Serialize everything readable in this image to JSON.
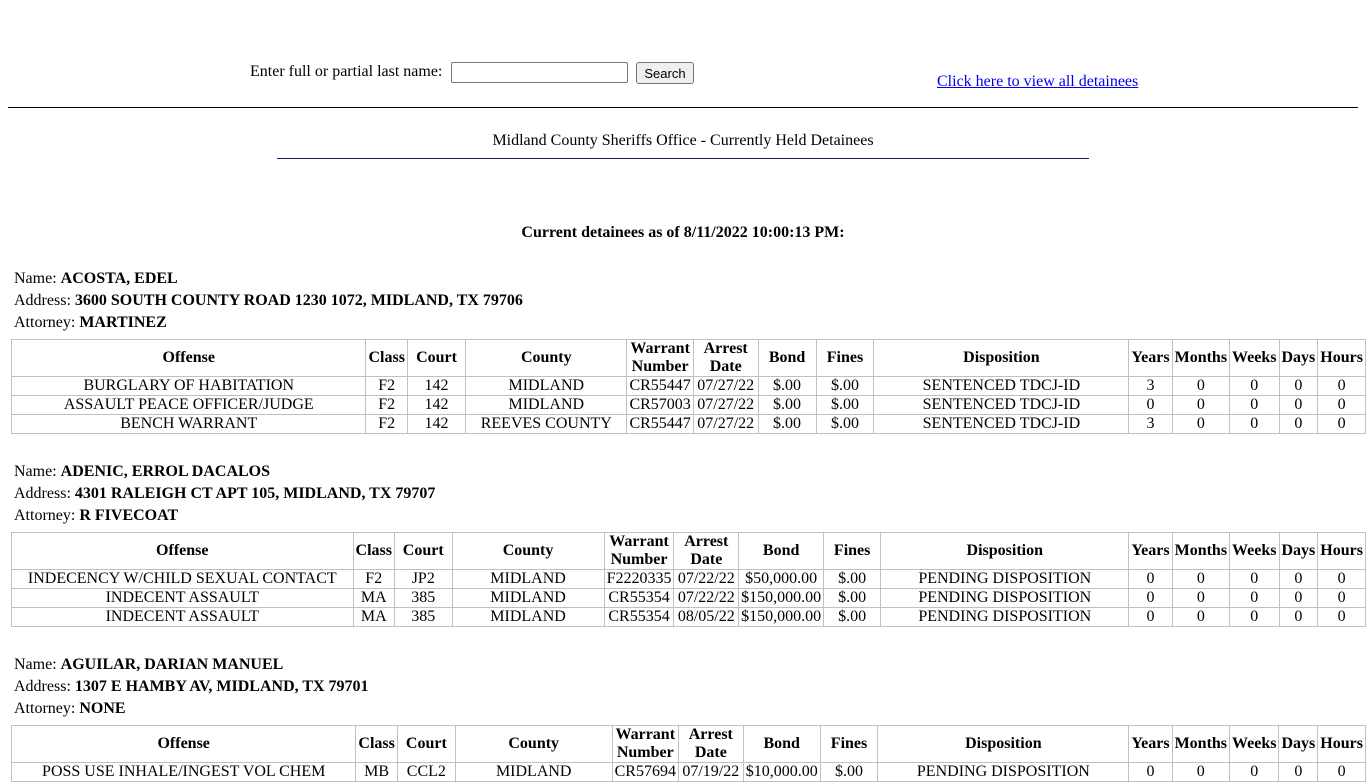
{
  "search": {
    "label": "Enter full or partial last name:",
    "input_value": "",
    "button_label": "Search"
  },
  "view_all_link": "Click here to view all detainees",
  "office_title": "Midland County Sheriffs Office - Currently Held Detainees",
  "as_of": "Current detainees as of 8/11/2022 10:00:13 PM:",
  "labels": {
    "name": "Name:",
    "address": "Address:",
    "attorney": "Attorney:"
  },
  "columns": [
    "Offense",
    "Class",
    "Court",
    "County",
    "Warrant Number",
    "Arrest Date",
    "Bond",
    "Fines",
    "Disposition",
    "Years",
    "Months",
    "Weeks",
    "Days",
    "Hours"
  ],
  "detainees": [
    {
      "name": "ACOSTA, EDEL",
      "address": "3600 SOUTH COUNTY ROAD 1230 1072, MIDLAND, TX 79706",
      "attorney": "MARTINEZ",
      "offenses": [
        [
          "BURGLARY OF HABITATION",
          "F2",
          "142",
          "MIDLAND",
          "CR55447",
          "07/27/22",
          "$.00",
          "$.00",
          "SENTENCED TDCJ-ID",
          "3",
          "0",
          "0",
          "0",
          "0"
        ],
        [
          "ASSAULT PEACE OFFICER/JUDGE",
          "F2",
          "142",
          "MIDLAND",
          "CR57003",
          "07/27/22",
          "$.00",
          "$.00",
          "SENTENCED TDCJ-ID",
          "0",
          "0",
          "0",
          "0",
          "0"
        ],
        [
          "BENCH WARRANT",
          "F2",
          "142",
          "REEVES COUNTY",
          "CR55447",
          "07/27/22",
          "$.00",
          "$.00",
          "SENTENCED TDCJ-ID",
          "3",
          "0",
          "0",
          "0",
          "0"
        ]
      ]
    },
    {
      "name": "ADENIC, ERROL DACALOS",
      "address": "4301 RALEIGH CT APT 105, MIDLAND, TX 79707",
      "attorney": "R FIVECOAT",
      "offenses": [
        [
          "INDECENCY W/CHILD SEXUAL CONTACT",
          "F2",
          "JP2",
          "MIDLAND",
          "F2220335",
          "07/22/22",
          "$50,000.00",
          "$.00",
          "PENDING DISPOSITION",
          "0",
          "0",
          "0",
          "0",
          "0"
        ],
        [
          "INDECENT ASSAULT",
          "MA",
          "385",
          "MIDLAND",
          "CR55354",
          "07/22/22",
          "$150,000.00",
          "$.00",
          "PENDING DISPOSITION",
          "0",
          "0",
          "0",
          "0",
          "0"
        ],
        [
          "INDECENT ASSAULT",
          "MA",
          "385",
          "MIDLAND",
          "CR55354",
          "08/05/22",
          "$150,000.00",
          "$.00",
          "PENDING DISPOSITION",
          "0",
          "0",
          "0",
          "0",
          "0"
        ]
      ]
    },
    {
      "name": "AGUILAR, DARIAN MANUEL",
      "address": "1307 E HAMBY AV, MIDLAND, TX 79701",
      "attorney": "NONE",
      "offenses": [
        [
          "POSS USE INHALE/INGEST VOL CHEM",
          "MB",
          "CCL2",
          "MIDLAND",
          "CR57694",
          "07/19/22",
          "$10,000.00",
          "$.00",
          "PENDING DISPOSITION",
          "0",
          "0",
          "0",
          "0",
          "0"
        ]
      ]
    }
  ]
}
